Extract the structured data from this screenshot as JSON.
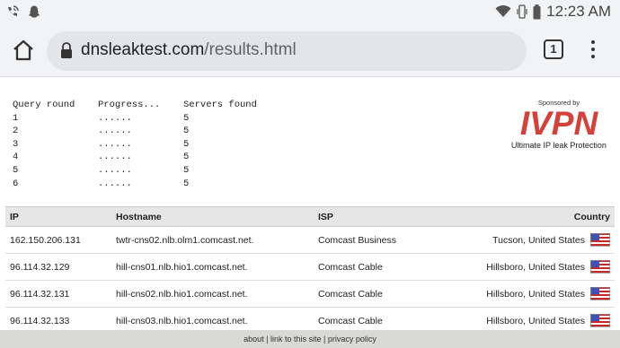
{
  "status": {
    "time": "12:23 AM",
    "icons": [
      "wifi-call-icon",
      "snapchat-icon",
      "wifi-icon",
      "vibrate-icon",
      "battery-icon"
    ]
  },
  "browser": {
    "url_domain": "dnsleaktest.com",
    "url_path": "/results.html",
    "tab_count": "1"
  },
  "query": {
    "headers": [
      "Query round",
      "Progress...",
      "Servers found"
    ],
    "rows": [
      [
        "1",
        "......",
        "5"
      ],
      [
        "2",
        "......",
        "5"
      ],
      [
        "3",
        "......",
        "5"
      ],
      [
        "4",
        "......",
        "5"
      ],
      [
        "5",
        "......",
        "5"
      ],
      [
        "6",
        "......",
        "5"
      ]
    ]
  },
  "sponsor": {
    "label": "Sponsored by",
    "logo_text": "IVPN",
    "tagline": "Ultimate IP leak Protection",
    "brand_color": "#d6403a"
  },
  "results": {
    "headers": {
      "ip": "IP",
      "hostname": "Hostname",
      "isp": "ISP",
      "country": "Country"
    },
    "rows": [
      {
        "ip": "162.150.206.131",
        "hostname": "twtr-cns02.nlb.olm1.comcast.net.",
        "isp": "Comcast Business",
        "country": "Tucson, United States"
      },
      {
        "ip": "96.114.32.129",
        "hostname": "hill-cns01.nlb.hio1.comcast.net.",
        "isp": "Comcast Cable",
        "country": "Hillsboro, United States"
      },
      {
        "ip": "96.114.32.131",
        "hostname": "hill-cns02.nlb.hio1.comcast.net.",
        "isp": "Comcast Cable",
        "country": "Hillsboro, United States"
      },
      {
        "ip": "96.114.32.133",
        "hostname": "hill-cns03.nlb.hio1.comcast.net.",
        "isp": "Comcast Cable",
        "country": "Hillsboro, United States"
      }
    ]
  },
  "footer": {
    "about": "about",
    "sep1": " | ",
    "link": "link to this site",
    "sep2": " | ",
    "privacy": "privacy policy"
  }
}
